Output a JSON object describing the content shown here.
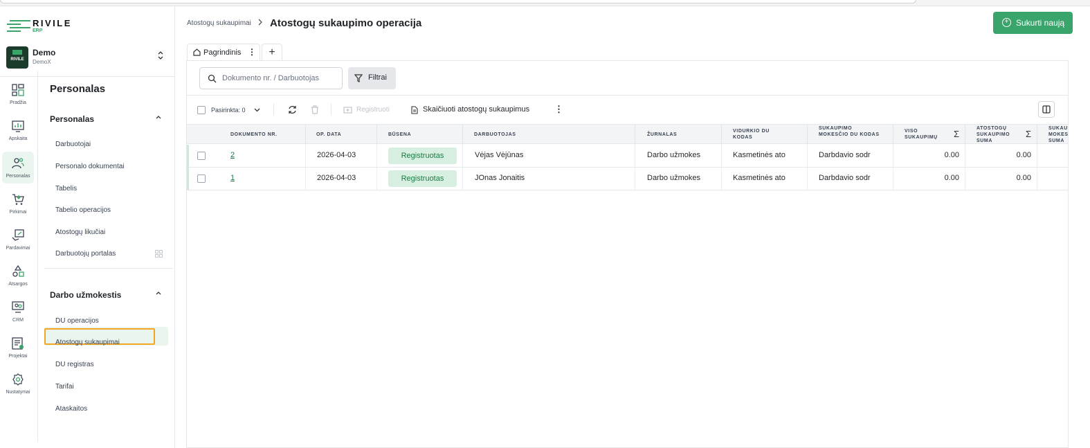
{
  "brand": {
    "name": "RIVILE",
    "sub": "ERP"
  },
  "company": {
    "name": "Demo",
    "sub": "DemoX",
    "logo_text": "RIVILE"
  },
  "rail": [
    {
      "label": "Pradžia",
      "icon": "dashboard-icon"
    },
    {
      "label": "Apskaita",
      "icon": "chart-icon"
    },
    {
      "label": "Personalas",
      "icon": "people-icon"
    },
    {
      "label": "Pirkimai",
      "icon": "cart-icon"
    },
    {
      "label": "Pardavimai",
      "icon": "sales-icon"
    },
    {
      "label": "Atsargos",
      "icon": "shapes-icon"
    },
    {
      "label": "CRM",
      "icon": "crm-icon"
    },
    {
      "label": "Projektai",
      "icon": "projects-icon"
    },
    {
      "label": "Nustatymai",
      "icon": "gear-icon"
    }
  ],
  "nav": {
    "title": "Personalas",
    "group1": {
      "label": "Personalas",
      "items": [
        "Darbuotojai",
        "Personalo dokumentai",
        "Tabelis",
        "Tabelio operacijos",
        "Atostogų likučiai",
        "Darbuotojų portalas"
      ]
    },
    "group2": {
      "label": "Darbo užmokestis",
      "items": [
        "DU operacijos",
        "Atostogų sukaupimai",
        "DU registras",
        "Tarifai",
        "Ataskaitos"
      ]
    }
  },
  "header": {
    "breadcrumb": "Atostogų sukaupimai",
    "title": "Atostogų sukaupimo operacija",
    "create_label": "Sukurti naują"
  },
  "tab": {
    "label": "Pagrindinis",
    "add": "+"
  },
  "search": {
    "placeholder": "Dokumento nr. / Darbuotojas"
  },
  "filters_label": "Filtrai",
  "toolbar": {
    "selected": "Pasirinkta: 0",
    "register": "Registruoti",
    "calculate": "Skaičiuoti atostogų sukaupimus"
  },
  "table": {
    "columns": [
      "DOKUMENTO NR.",
      "OP. DATA",
      "BŪSENA",
      "DARBUOTOJAS",
      "ŽURNALAS",
      "VIDURKIO DU KODAS",
      "SUKAUPIMO MOKESČIO DU KODAS",
      "VISO SUKAUPIMŲ",
      "ATOSTOGŲ SUKAUPIMO SUMA",
      "SUKAU MOKES SUMA"
    ],
    "rows": [
      {
        "doc": "2",
        "date": "2026-04-03",
        "status": "Registruotas",
        "employee": "Vėjas Vėjūnas",
        "journal": "Darbo užmokes",
        "avg_code": "Kasmetinės ato",
        "tax_code": "Darbdavio sodr",
        "total": "0.00",
        "sum": "0.00"
      },
      {
        "doc": "1",
        "date": "2026-04-03",
        "status": "Registruotas",
        "employee": "JOnas Jonaitis",
        "journal": "Darbo užmokes",
        "avg_code": "Kasmetinės ato",
        "tax_code": "Darbdavio sodr",
        "total": "0.00",
        "sum": "0.00"
      }
    ]
  },
  "colors": {
    "accent": "#3aa56a",
    "badge_bg": "#d7efe0",
    "highlight": "#f5a524"
  }
}
